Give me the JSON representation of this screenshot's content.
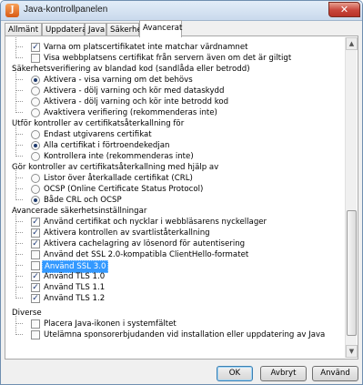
{
  "window": {
    "title": "Java-kontrollpanelen",
    "app_icon": "java-icon",
    "close_glyph": "✕"
  },
  "tabs": [
    "Allmänt",
    "Uppdatera",
    "Java",
    "Säkerhet",
    "Avancerat"
  ],
  "active_tab": "Avancerat",
  "settings": {
    "r0": "Varna om platscertifikatet inte matchar värdnamnet",
    "r1": "Visa webbplatsens certifikat från servern även om det är giltigt",
    "h1": "Säkerhetsverifiering av blandad kod (sandlåda eller betrodd)",
    "r2": "Aktivera - visa varning om det behövs",
    "r3": "Aktivera - dölj varning och kör med dataskydd",
    "r4": "Aktivera - dölj varning och kör inte betrodd kod",
    "r5": "Avaktivera verifiering (rekommenderas inte)",
    "h2": "Utför kontroller av certifikatsåterkallning för",
    "r6": "Endast utgivarens certifikat",
    "r7": "Alla certifikat i förtroendekedjan",
    "r8": "Kontrollera inte (rekommenderas inte)",
    "h3": "Gör kontroller av certifikatsåterkallning med hjälp av",
    "r9": "Listor över återkallade certifikat (CRL)",
    "r10": "OCSP (Online Certificate Status Protocol)",
    "r11": "Både CRL och OCSP",
    "h4": "Avancerade säkerhetsinställningar",
    "r12": "Använd certifikat och nycklar i webbläsarens nyckellager",
    "r13": "Aktivera kontrollen av svartliståterkallning",
    "r14": "Aktivera cachelagring av lösenord för autentisering",
    "r15": "Använd det SSL 2.0-kompatibla ClientHello-formatet",
    "r16": "Använd SSL 3.0",
    "r17": "Använd TLS 1.0",
    "r18": "Använd TLS 1.1",
    "r19": "Använd TLS 1.2",
    "h5": "Diverse",
    "r20": "Placera Java-ikonen i systemfältet",
    "r21": "Utelämna sponsorerbjudanden vid installation eller uppdatering av Java"
  },
  "states": {
    "r0": true,
    "r1": false,
    "r2": true,
    "r3": false,
    "r4": false,
    "r5": false,
    "r6": false,
    "r7": true,
    "r8": false,
    "r9": false,
    "r10": false,
    "r11": true,
    "r12": true,
    "r13": true,
    "r14": true,
    "r15": false,
    "r16": false,
    "r17": true,
    "r18": true,
    "r19": true,
    "r20": false,
    "r21": false
  },
  "selected_row": "r16",
  "buttons": {
    "ok": "OK",
    "cancel": "Avbryt",
    "apply": "Använd"
  },
  "colors": {
    "selection": "#3399ff",
    "titlebar": "#c9d9ec",
    "close": "#c8453a"
  }
}
